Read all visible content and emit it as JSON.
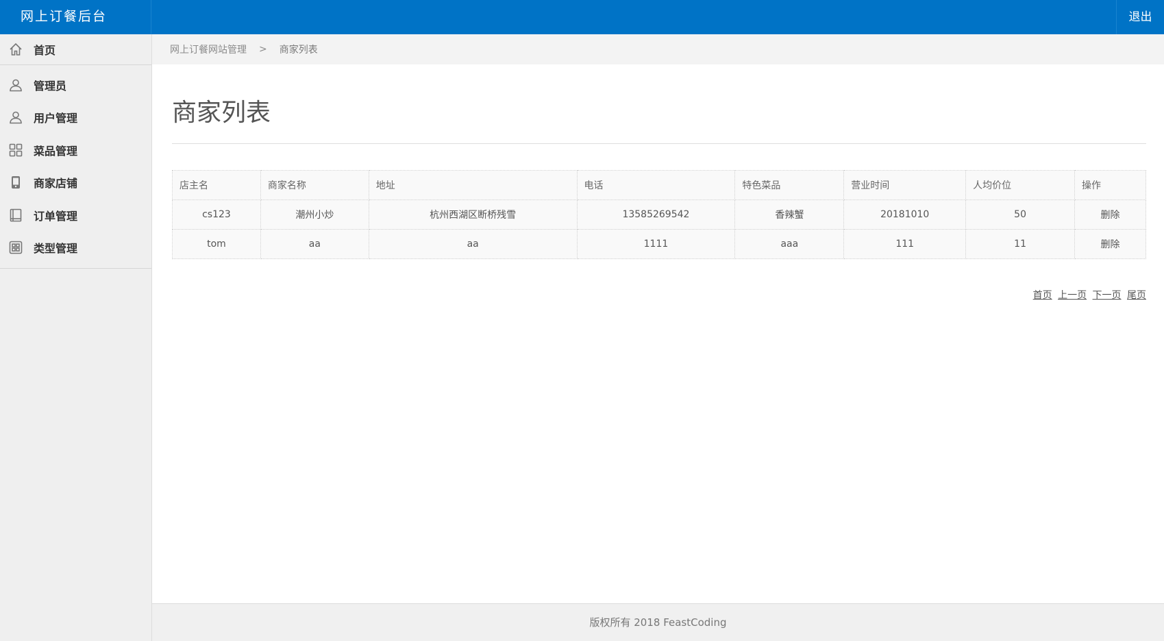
{
  "header": {
    "brand": "网上订餐后台",
    "logout_label": "退出",
    "accent_color": "#0073c6"
  },
  "sidebar": {
    "home": {
      "label": "首页",
      "icon": "home-icon"
    },
    "items": [
      {
        "label": "管理员",
        "icon": "user-icon"
      },
      {
        "label": "用户管理",
        "icon": "user-icon"
      },
      {
        "label": "菜品管理",
        "icon": "grid-icon"
      },
      {
        "label": "商家店铺",
        "icon": "phone-icon"
      },
      {
        "label": "订单管理",
        "icon": "book-icon"
      },
      {
        "label": "类型管理",
        "icon": "grid-box-icon"
      }
    ]
  },
  "breadcrumb": {
    "root": "网上订餐网站管理",
    "separator": ">",
    "current": "商家列表"
  },
  "main": {
    "title": "商家列表"
  },
  "table": {
    "columns": [
      "店主名",
      "商家名称",
      "地址",
      "电话",
      "特色菜品",
      "营业时间",
      "人均价位",
      "操作"
    ],
    "rows": [
      [
        "cs123",
        "潮州小炒",
        "杭州西湖区断桥残雪",
        "13585269542",
        "香辣蟹",
        "20181010",
        "50",
        "删除"
      ],
      [
        "tom",
        "aa",
        "aa",
        "1111",
        "aaa",
        "111",
        "11",
        "删除"
      ]
    ]
  },
  "pager": {
    "first": "首页",
    "prev": "上一页",
    "next": "下一页",
    "last": "尾页"
  },
  "footer": {
    "text": "版权所有 2018 FeastCoding"
  }
}
